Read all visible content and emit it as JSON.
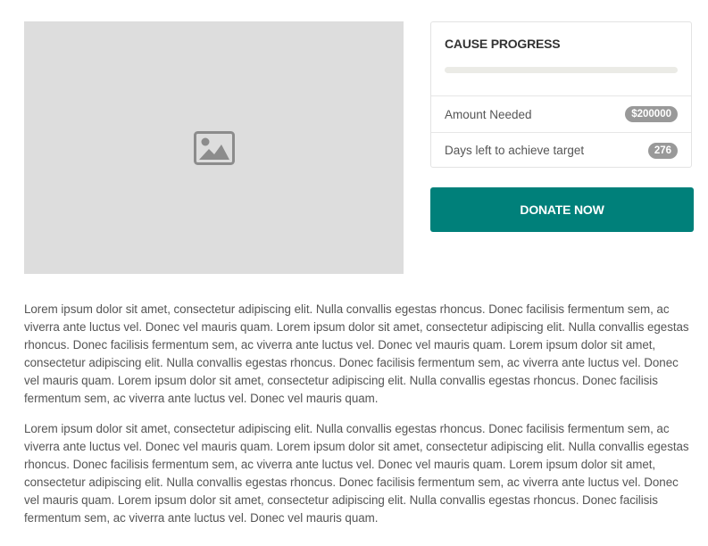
{
  "media": {
    "icon": "image-placeholder-icon"
  },
  "cause": {
    "title": "CAUSE PROGRESS",
    "progress_fraction": 0,
    "rows": [
      {
        "label": "Amount Needed",
        "value": "$200000"
      },
      {
        "label": "Days left to achieve target",
        "value": "276"
      }
    ],
    "donate_label": "DONATE NOW"
  },
  "content": {
    "paragraphs": [
      "Lorem ipsum dolor sit amet, consectetur adipiscing elit. Nulla convallis egestas rhoncus. Donec facilisis fermentum sem, ac viverra ante luctus vel. Donec vel mauris quam. Lorem ipsum dolor sit amet, consectetur adipiscing elit. Nulla convallis egestas rhoncus. Donec facilisis fermentum sem, ac viverra ante luctus vel. Donec vel mauris quam. Lorem ipsum dolor sit amet, consectetur adipiscing elit. Nulla convallis egestas rhoncus. Donec facilisis fermentum sem, ac viverra ante luctus vel. Donec vel mauris quam. Lorem ipsum dolor sit amet, consectetur adipiscing elit. Nulla convallis egestas rhoncus. Donec facilisis fermentum sem, ac viverra ante luctus vel. Donec vel mauris quam.",
      "Lorem ipsum dolor sit amet, consectetur adipiscing elit. Nulla convallis egestas rhoncus. Donec facilisis fermentum sem, ac viverra ante luctus vel. Donec vel mauris quam. Lorem ipsum dolor sit amet, consectetur adipiscing elit. Nulla convallis egestas rhoncus. Donec facilisis fermentum sem, ac viverra ante luctus vel. Donec vel mauris quam. Lorem ipsum dolor sit amet, consectetur adipiscing elit. Nulla convallis egestas rhoncus. Donec facilisis fermentum sem, ac viverra ante luctus vel. Donec vel mauris quam. Lorem ipsum dolor sit amet, consectetur adipiscing elit. Nulla convallis egestas rhoncus. Donec facilisis fermentum sem, ac viverra ante luctus vel. Donec vel mauris quam."
    ]
  },
  "colors": {
    "accent": "#00807a",
    "placeholder_bg": "#dddddd",
    "badge_bg": "#999999",
    "progress_track": "#ebebe6"
  }
}
